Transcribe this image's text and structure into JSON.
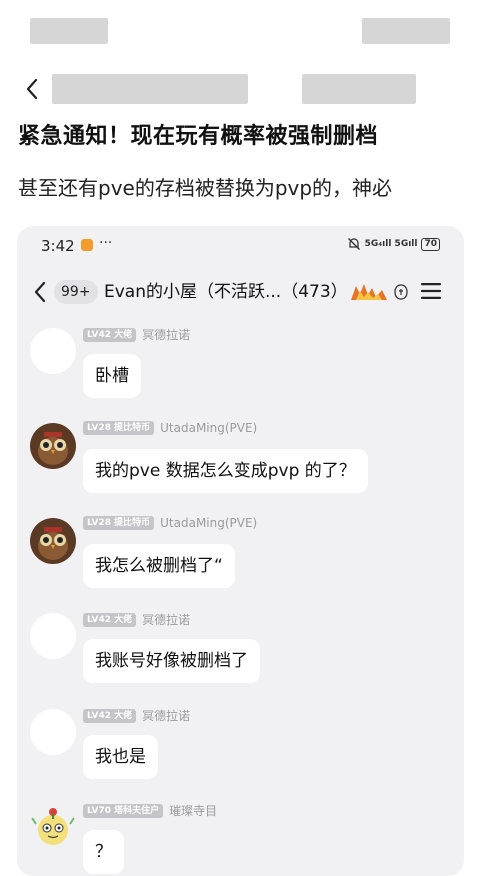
{
  "post": {
    "title": "紧急通知！现在玩有概率被强制删档",
    "body": "甚至还有pve的存档被替换为pvp的，神必"
  },
  "status_bar": {
    "time": "3:42",
    "dots": "···",
    "network": "5G₄ıll 5Gıll",
    "battery": "70"
  },
  "chat_header": {
    "unread_badge": "99+",
    "title": "Evan的小屋（不活跃...（473）"
  },
  "messages": [
    {
      "level": "LV42 大佬",
      "nick": "冥德拉诺",
      "text": "卧槽",
      "avatar": "blank"
    },
    {
      "level": "LV28 提比特币",
      "nick": "UtadaMing(PVE)",
      "text": "我的pve 数据怎么变成pvp 的了？",
      "avatar": "owl"
    },
    {
      "level": "LV28 提比特币",
      "nick": "UtadaMing(PVE)",
      "text": "我怎么被删档了“",
      "avatar": "owl"
    },
    {
      "level": "LV42 大佬",
      "nick": "冥德拉诺",
      "text": "我账号好像被删档了",
      "avatar": "blank"
    },
    {
      "level": "LV42 大佬",
      "nick": "冥德拉诺",
      "text": "我也是",
      "avatar": "blank"
    },
    {
      "level": "LV70 塔科夫住户",
      "nick": "璀璨寺目",
      "text": "？",
      "avatar": "cartoon"
    }
  ],
  "colors": {
    "chat_background": "#f1f1f3",
    "bubble": "#ffffff",
    "level_tag": "#c4c4c9",
    "nick_text": "#9a9aa0"
  }
}
